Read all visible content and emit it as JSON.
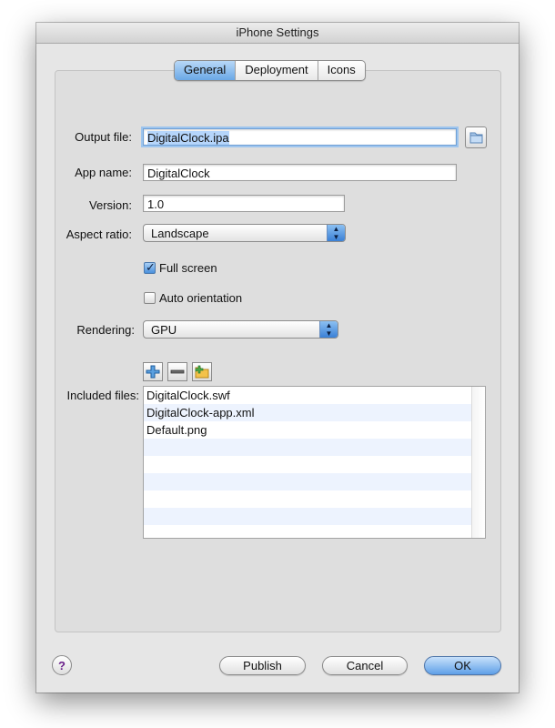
{
  "window": {
    "title": "iPhone Settings"
  },
  "tabs": [
    {
      "label": "General",
      "selected": true
    },
    {
      "label": "Deployment",
      "selected": false
    },
    {
      "label": "Icons",
      "selected": false
    }
  ],
  "form": {
    "output_file_label": "Output file:",
    "output_file_value": "DigitalClock.ipa",
    "app_name_label": "App name:",
    "app_name_value": "DigitalClock",
    "version_label": "Version:",
    "version_value": "1.0",
    "aspect_ratio_label": "Aspect ratio:",
    "aspect_ratio_value": "Landscape",
    "full_screen_label": "Full screen",
    "full_screen_checked": true,
    "auto_orientation_label": "Auto orientation",
    "auto_orientation_checked": false,
    "rendering_label": "Rendering:",
    "rendering_value": "GPU",
    "included_files_label": "Included files:",
    "included_files": [
      "DigitalClock.swf",
      "DigitalClock-app.xml",
      "Default.png"
    ]
  },
  "buttons": {
    "publish": "Publish",
    "cancel": "Cancel",
    "ok": "OK",
    "help": "?"
  },
  "colors": {
    "accent": "#5e9fe8",
    "window_bg": "#e6e6e6",
    "list_stripe": "#edf3fe"
  }
}
